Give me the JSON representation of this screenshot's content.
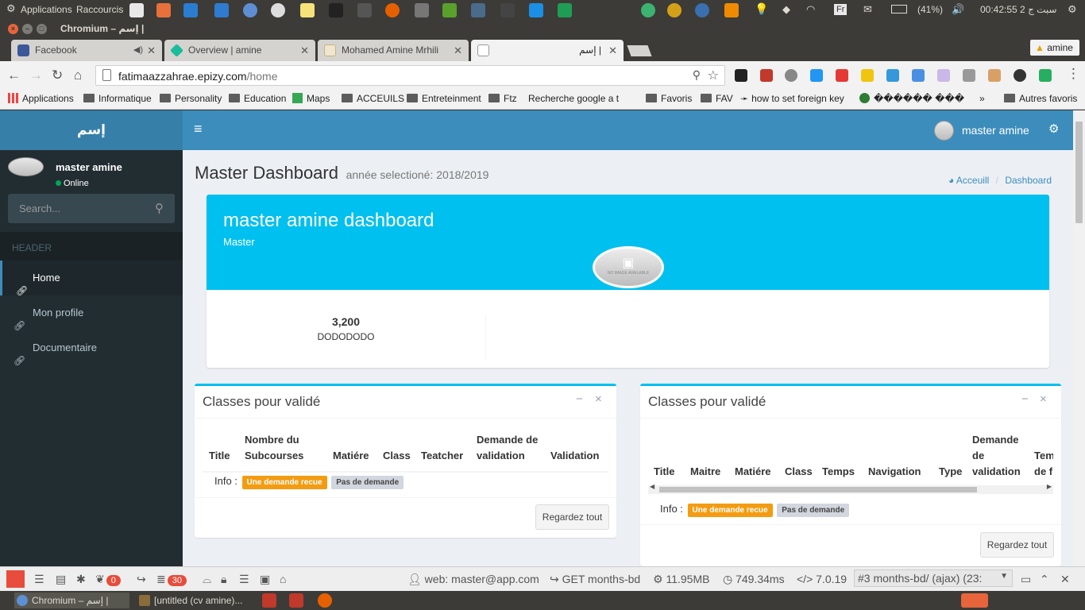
{
  "os_bar": {
    "applications": "Applications",
    "shortcuts": "Raccourcis",
    "lang": "Fr",
    "battery": "(41%)",
    "clock": "00:42:55 2 ﺳﺒﺖ ﺝ"
  },
  "window": {
    "title": "Chromium – إسم |"
  },
  "tabs": [
    {
      "label": "Facebook",
      "color": "#3b5998"
    },
    {
      "label": "Overview | amine",
      "color": "#1abc9c"
    },
    {
      "label": "Mohamed Amine Mrhili",
      "color": "#f0e6d0"
    },
    {
      "label": "إسم |",
      "color": "#ffffff"
    }
  ],
  "profile_badge": "amine",
  "address": {
    "host": "fatimaazzahrae.epizy.com",
    "path": "/home"
  },
  "bookmarks": [
    "Applications",
    "Informatique",
    "Personality",
    "Education",
    "Maps",
    "ACCEUILS",
    "Entreteinment",
    "Ftz",
    "Recherche google a t",
    "Favoris",
    "FAV",
    "how to set foreign key",
    "������ ��� ��",
    "Autres favoris"
  ],
  "app": {
    "logo": "إسم",
    "user_name": "master amine",
    "status": "Online",
    "search_placeholder": "Search...",
    "menu_header": "HEADER",
    "menu": [
      "Home",
      "Mon profile",
      "Documentaire"
    ]
  },
  "page": {
    "title": "Master Dashboard",
    "subtitle": "année selectioné: 2018/2019",
    "breadcrumb": [
      "Acceuill",
      "Dashboard"
    ]
  },
  "widget": {
    "name": "master amine dashboard",
    "role": "Master",
    "avatar_caption": "NO IMAGE AVAILABLE",
    "stat_value": "3,200",
    "stat_label": "DODODODO"
  },
  "box_left": {
    "title": "Classes pour validé",
    "columns": [
      "Title",
      "Nombre du Subcourses",
      "Matiére",
      "Class",
      "Teatcher",
      "Demande de validation",
      "Validation"
    ],
    "info_label": "Info :",
    "badge1": "Une demande recue",
    "badge2": "Pas de demande",
    "button": "Regardez tout"
  },
  "box_right": {
    "title": "Classes pour validé",
    "columns": [
      "Title",
      "Maitre",
      "Matiére",
      "Class",
      "Temps",
      "Navigation",
      "Type",
      "Demande de validation",
      "Temps de f"
    ],
    "info_label": "Info :",
    "badge1": "Une demande recue",
    "badge2": "Pas de demande",
    "button": "Regardez tout"
  },
  "debugbar": {
    "messages_count": "0",
    "queries_count": "30",
    "user": "web: master@app.com",
    "route": "GET months-bd",
    "memory": "11.95MB",
    "time": "749.34ms",
    "php": "7.0.19",
    "request": "#3 months-bd/ (ajax) (23:"
  },
  "taskbar": [
    {
      "label": "Chromium – إسم |"
    },
    {
      "label": "[untitled (cv amine)..."
    }
  ],
  "colors": {
    "primary": "#3c8dbc",
    "info": "#00c0ef",
    "sidebar": "#222d32",
    "warning": "#f39c12"
  }
}
